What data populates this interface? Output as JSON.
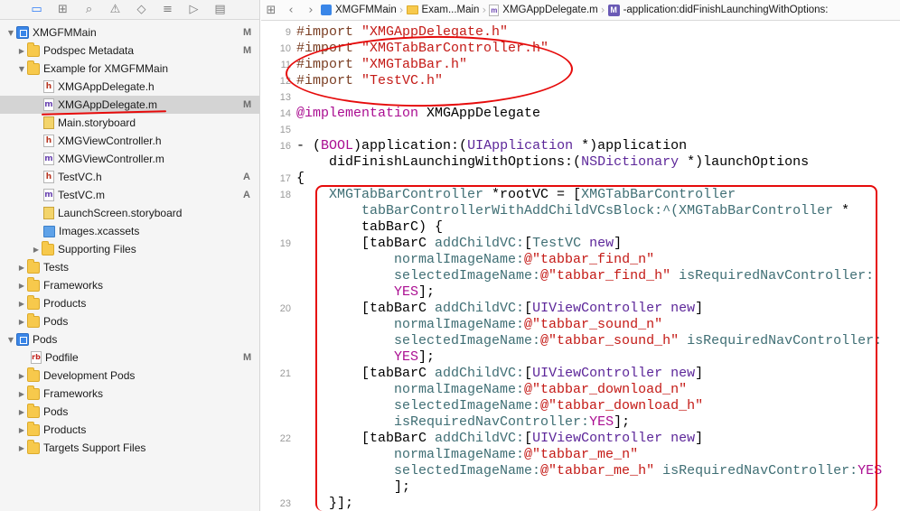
{
  "navigator": {
    "toolbar_icons": [
      "folder-icon",
      "hierarchy-icon",
      "search-icon",
      "warning-icon",
      "test-icon",
      "debug-icon",
      "breakpoint-icon",
      "report-icon"
    ],
    "items": [
      {
        "label": "XMGFMMain",
        "badge": "M",
        "icon": "proj",
        "disclosure": "▼"
      },
      {
        "label": "Podspec Metadata",
        "badge": "M",
        "icon": "folder",
        "disclosure": "▶"
      },
      {
        "label": "Example for XMGFMMain",
        "badge": "",
        "icon": "folder",
        "disclosure": "▼"
      },
      {
        "label": "XMGAppDelegate.h",
        "badge": "",
        "icon": "h",
        "disclosure": ""
      },
      {
        "label": "XMGAppDelegate.m",
        "badge": "M",
        "icon": "m",
        "disclosure": ""
      },
      {
        "label": "Main.storyboard",
        "badge": "",
        "icon": "sb",
        "disclosure": ""
      },
      {
        "label": "XMGViewController.h",
        "badge": "",
        "icon": "h",
        "disclosure": ""
      },
      {
        "label": "XMGViewController.m",
        "badge": "",
        "icon": "m",
        "disclosure": ""
      },
      {
        "label": "TestVC.h",
        "badge": "A",
        "icon": "h",
        "disclosure": ""
      },
      {
        "label": "TestVC.m",
        "badge": "A",
        "icon": "m",
        "disclosure": ""
      },
      {
        "label": "LaunchScreen.storyboard",
        "badge": "",
        "icon": "sb",
        "disclosure": ""
      },
      {
        "label": "Images.xcassets",
        "badge": "",
        "icon": "assets",
        "disclosure": ""
      },
      {
        "label": "Supporting Files",
        "badge": "",
        "icon": "folder",
        "disclosure": "▶"
      },
      {
        "label": "Tests",
        "badge": "",
        "icon": "folder",
        "disclosure": "▶"
      },
      {
        "label": "Frameworks",
        "badge": "",
        "icon": "folder",
        "disclosure": "▶"
      },
      {
        "label": "Products",
        "badge": "",
        "icon": "folder",
        "disclosure": "▶"
      },
      {
        "label": "Pods",
        "badge": "",
        "icon": "folder",
        "disclosure": "▶"
      },
      {
        "label": "Pods",
        "badge": "",
        "icon": "proj",
        "disclosure": "▼"
      },
      {
        "label": "Podfile",
        "badge": "M",
        "icon": "rb",
        "disclosure": ""
      },
      {
        "label": "Development Pods",
        "badge": "",
        "icon": "folder",
        "disclosure": "▶"
      },
      {
        "label": "Frameworks",
        "badge": "",
        "icon": "folder",
        "disclosure": "▶"
      },
      {
        "label": "Pods",
        "badge": "",
        "icon": "folder",
        "disclosure": "▶"
      },
      {
        "label": "Products",
        "badge": "",
        "icon": "folder",
        "disclosure": "▶"
      },
      {
        "label": "Targets Support Files",
        "badge": "",
        "icon": "folder",
        "disclosure": "▶"
      }
    ]
  },
  "jumpbar": {
    "project": "XMGFMMain",
    "group": "Exam...Main",
    "file": "XMGAppDelegate.m",
    "method_badge": "M",
    "method": "-application:didFinishLaunchingWithOptions:"
  },
  "editor": {
    "line_numbers": [
      "9",
      "10",
      "11",
      "12",
      "13",
      "14",
      "15",
      "16",
      "17",
      "18",
      "19",
      "20",
      "21",
      "22",
      "23"
    ],
    "lines": [
      [
        {
          "t": "#import ",
          "c": "pp"
        },
        {
          "t": "\"XMGAppDelegate.h\"",
          "c": "str"
        }
      ],
      [
        {
          "t": "#import ",
          "c": "pp"
        },
        {
          "t": "\"XMGTabBarController.h\"",
          "c": "str"
        }
      ],
      [
        {
          "t": "#import ",
          "c": "pp"
        },
        {
          "t": "\"XMGTabBar.h\"",
          "c": "str"
        }
      ],
      [
        {
          "t": "#import ",
          "c": "pp"
        },
        {
          "t": "\"TestVC.h\"",
          "c": "str"
        }
      ],
      [],
      [
        {
          "t": "@implementation",
          "c": "kw"
        },
        {
          "t": " XMGAppDelegate",
          "c": "plain"
        }
      ],
      [],
      [
        {
          "t": "- (",
          "c": "plain"
        },
        {
          "t": "BOOL",
          "c": "kw"
        },
        {
          "t": ")application:(",
          "c": "plain"
        },
        {
          "t": "UIApplication",
          "c": "sys"
        },
        {
          "t": " *)application",
          "c": "plain"
        }
      ],
      [
        {
          "t": "    didFinishLaunchingWithOptions:(",
          "c": "plain"
        },
        {
          "t": "NSDictionary",
          "c": "sys"
        },
        {
          "t": " *)launchOptions",
          "c": "plain"
        }
      ],
      [
        {
          "t": "{",
          "c": "plain"
        }
      ],
      [
        {
          "t": "    ",
          "c": "plain"
        },
        {
          "t": "XMGTabBarController",
          "c": "cls"
        },
        {
          "t": " *rootVC = [",
          "c": "plain"
        },
        {
          "t": "XMGTabBarController",
          "c": "cls"
        }
      ],
      [
        {
          "t": "        tabBarControllerWithAddChildVCsBlock:^(",
          "c": "cls"
        },
        {
          "t": "XMGTabBarController",
          "c": "cls"
        },
        {
          "t": " *",
          "c": "plain"
        }
      ],
      [
        {
          "t": "        tabBarC) {",
          "c": "plain"
        }
      ],
      [
        {
          "t": "        [tabBarC ",
          "c": "plain"
        },
        {
          "t": "addChildVC:",
          "c": "cls"
        },
        {
          "t": "[",
          "c": "plain"
        },
        {
          "t": "TestVC",
          "c": "cls"
        },
        {
          "t": " ",
          "c": "plain"
        },
        {
          "t": "new",
          "c": "sys"
        },
        {
          "t": "]",
          "c": "plain"
        }
      ],
      [
        {
          "t": "            normalImageName:",
          "c": "cls"
        },
        {
          "t": "@\"tabbar_find_n\"",
          "c": "str"
        }
      ],
      [
        {
          "t": "            selectedImageName:",
          "c": "cls"
        },
        {
          "t": "@\"tabbar_find_h\"",
          "c": "str"
        },
        {
          "t": " isRequiredNavController:",
          "c": "cls"
        }
      ],
      [
        {
          "t": "            ",
          "c": "plain"
        },
        {
          "t": "YES",
          "c": "kw"
        },
        {
          "t": "];",
          "c": "plain"
        }
      ],
      [
        {
          "t": "        [tabBarC ",
          "c": "plain"
        },
        {
          "t": "addChildVC:",
          "c": "cls"
        },
        {
          "t": "[",
          "c": "plain"
        },
        {
          "t": "UIViewController",
          "c": "sys"
        },
        {
          "t": " ",
          "c": "plain"
        },
        {
          "t": "new",
          "c": "sys"
        },
        {
          "t": "]",
          "c": "plain"
        }
      ],
      [
        {
          "t": "            normalImageName:",
          "c": "cls"
        },
        {
          "t": "@\"tabbar_sound_n\"",
          "c": "str"
        }
      ],
      [
        {
          "t": "            selectedImageName:",
          "c": "cls"
        },
        {
          "t": "@\"tabbar_sound_h\"",
          "c": "str"
        },
        {
          "t": " isRequiredNavController:",
          "c": "cls"
        }
      ],
      [
        {
          "t": "            ",
          "c": "plain"
        },
        {
          "t": "YES",
          "c": "kw"
        },
        {
          "t": "];",
          "c": "plain"
        }
      ],
      [
        {
          "t": "        [tabBarC ",
          "c": "plain"
        },
        {
          "t": "addChildVC:",
          "c": "cls"
        },
        {
          "t": "[",
          "c": "plain"
        },
        {
          "t": "UIViewController",
          "c": "sys"
        },
        {
          "t": " ",
          "c": "plain"
        },
        {
          "t": "new",
          "c": "sys"
        },
        {
          "t": "]",
          "c": "plain"
        }
      ],
      [
        {
          "t": "            normalImageName:",
          "c": "cls"
        },
        {
          "t": "@\"tabbar_download_n\"",
          "c": "str"
        }
      ],
      [
        {
          "t": "            selectedImageName:",
          "c": "cls"
        },
        {
          "t": "@\"tabbar_download_h\"",
          "c": "str"
        }
      ],
      [
        {
          "t": "            isRequiredNavController:",
          "c": "cls"
        },
        {
          "t": "YES",
          "c": "kw"
        },
        {
          "t": "];",
          "c": "plain"
        }
      ],
      [
        {
          "t": "        [tabBarC ",
          "c": "plain"
        },
        {
          "t": "addChildVC:",
          "c": "cls"
        },
        {
          "t": "[",
          "c": "plain"
        },
        {
          "t": "UIViewController",
          "c": "sys"
        },
        {
          "t": " ",
          "c": "plain"
        },
        {
          "t": "new",
          "c": "sys"
        },
        {
          "t": "]",
          "c": "plain"
        }
      ],
      [
        {
          "t": "            normalImageName:",
          "c": "cls"
        },
        {
          "t": "@\"tabbar_me_n\"",
          "c": "str"
        }
      ],
      [
        {
          "t": "            selectedImageName:",
          "c": "cls"
        },
        {
          "t": "@\"tabbar_me_h\"",
          "c": "str"
        },
        {
          "t": " isRequiredNavController:",
          "c": "cls"
        },
        {
          "t": "YES",
          "c": "kw"
        }
      ],
      [
        {
          "t": "            ];",
          "c": "plain"
        }
      ],
      [
        {
          "t": "    }];",
          "c": "plain"
        }
      ]
    ]
  },
  "colors": {
    "annotation_red": "#e60b0b",
    "selection_gray": "#d4d4d4",
    "keyword": "#aa0d91",
    "string": "#c41a16",
    "preprocessor": "#7a3e23",
    "project_class": "#3f6e74",
    "system_class": "#5c2699"
  }
}
